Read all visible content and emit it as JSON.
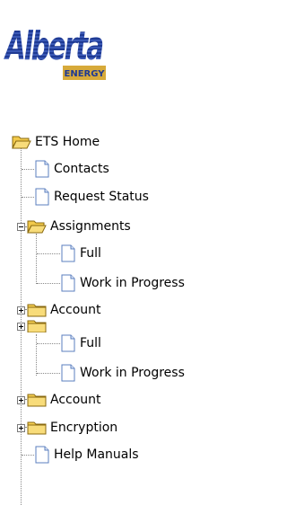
{
  "logo": {
    "wordmark": "Alberta",
    "sub": "ENERGY"
  },
  "tree": {
    "root": "ETS Home",
    "items": [
      {
        "label": "Contacts"
      },
      {
        "label": "Request Status"
      },
      {
        "label": "Assignments"
      },
      {
        "label": "Full"
      },
      {
        "label": "Work in Progress"
      },
      {
        "label": "Account"
      },
      {
        "label": "Full"
      },
      {
        "label": "Work in Progress"
      },
      {
        "label": "Account"
      },
      {
        "label": "Encryption"
      },
      {
        "label": "Help Manuals"
      }
    ]
  },
  "colors": {
    "brand": "#1f3a93",
    "accent": "#e0a21a",
    "folder": "#f5cf52"
  }
}
